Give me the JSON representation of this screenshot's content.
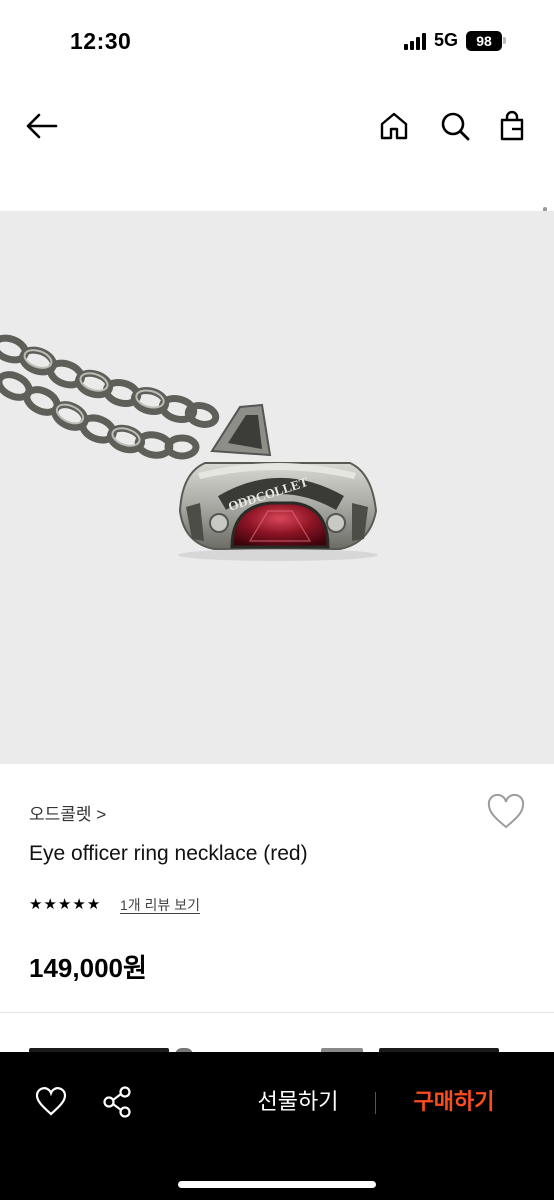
{
  "status_bar": {
    "time": "12:30",
    "network": "5G",
    "battery": "98"
  },
  "nav": {
    "icons": [
      "arrow-left-icon",
      "home-icon",
      "search-icon",
      "shopping-bag-icon"
    ]
  },
  "product": {
    "image_alt": "ODDCOLLET",
    "brand": "오드콜렛 >",
    "name": "Eye officer ring necklace (red)",
    "rating_stars": 5,
    "review_link": "1개 리뷰 보기",
    "price": "149,000원"
  },
  "bottom_bar": {
    "gift_label": "선물하기",
    "buy_label": "구매하기",
    "buy_color": "#ff4c1e"
  }
}
